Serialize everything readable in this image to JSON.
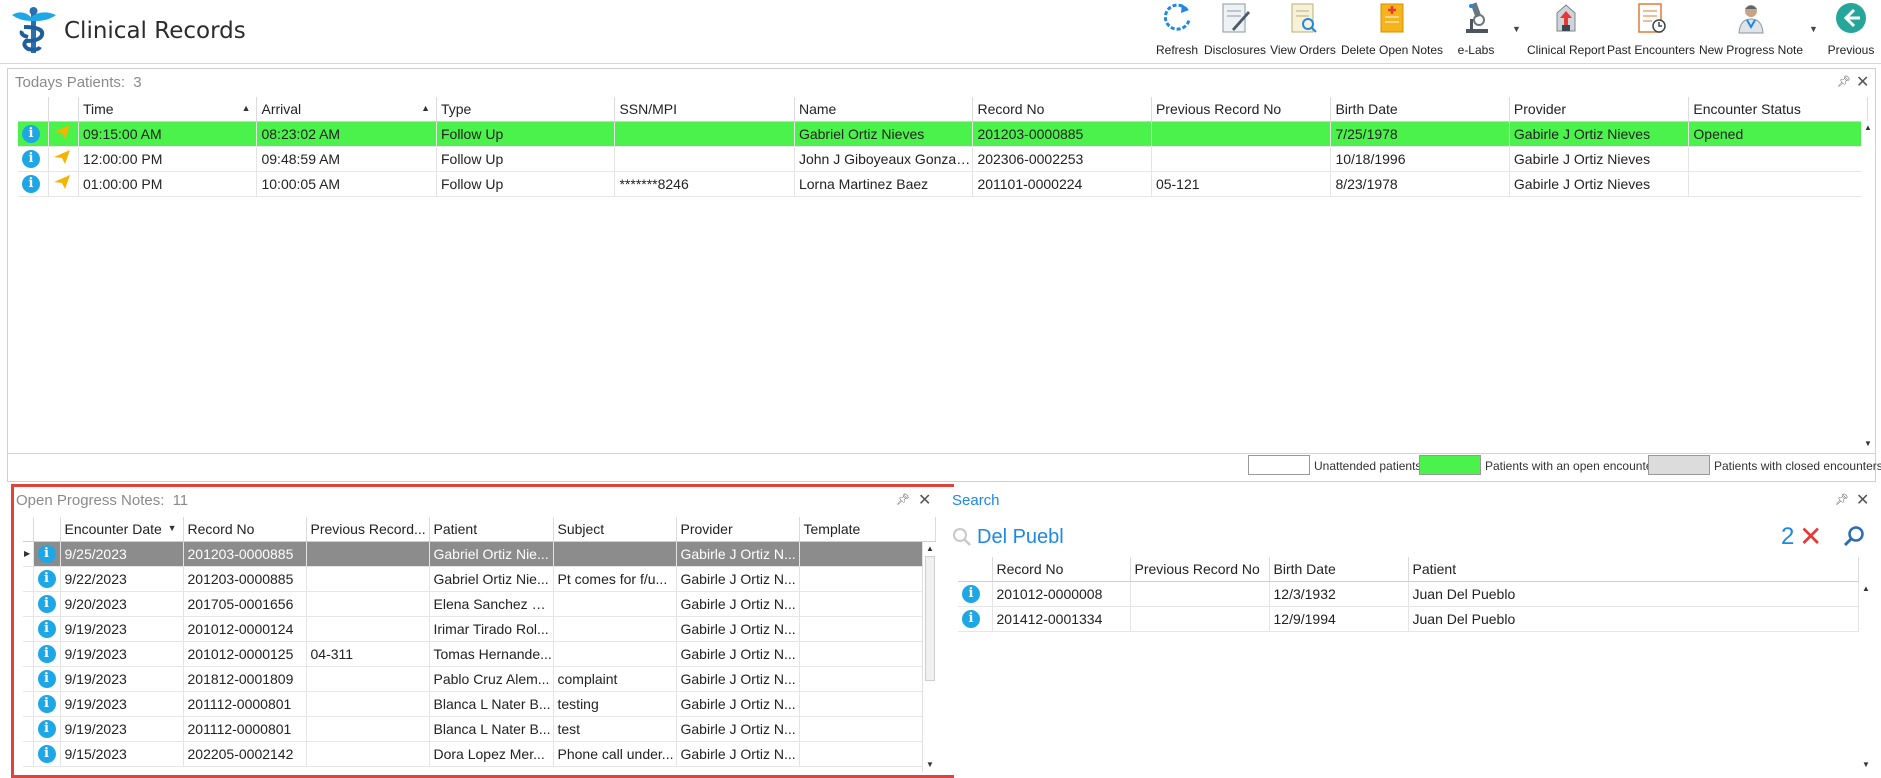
{
  "app": {
    "title": "Clinical Records"
  },
  "toolbar": [
    {
      "label": "Refresh",
      "icon": "refresh-icon"
    },
    {
      "label": "Disclosures",
      "icon": "disclosures-icon"
    },
    {
      "label": "View Orders",
      "icon": "view-orders-icon"
    },
    {
      "label": "Delete Open Notes",
      "icon": "delete-notes-icon"
    },
    {
      "label": "e-Labs",
      "icon": "microscope-icon"
    },
    {
      "label": "Clinical Report",
      "icon": "clinical-report-icon"
    },
    {
      "label": "Past Encounters",
      "icon": "past-encounters-icon"
    },
    {
      "label": "New Progress Note",
      "icon": "doctor-icon"
    },
    {
      "label": "Previous",
      "icon": "back-arrow-icon"
    }
  ],
  "todays": {
    "title": "Todays Patients:",
    "count": "3",
    "columns": [
      "Time",
      "Arrival",
      "Type",
      "SSN/MPI",
      "Name",
      "Record No",
      "Previous Record No",
      "Birth Date",
      "Provider",
      "Encounter Status"
    ],
    "rows": [
      [
        "09:15:00 AM",
        "08:23:02 AM",
        "Follow Up",
        "",
        "Gabriel Ortiz Nieves",
        "201203-0000885",
        "",
        "7/25/1978",
        "Gabirle J Ortiz Nieves",
        "Opened"
      ],
      [
        "12:00:00 PM",
        "09:48:59 AM",
        "Follow Up",
        "",
        "John J Giboyeaux Gonzalez",
        "202306-0002253",
        "",
        "10/18/1996",
        "Gabirle J Ortiz Nieves",
        ""
      ],
      [
        "01:00:00 PM",
        "10:00:05 AM",
        "Follow Up",
        "*******8246",
        "Lorna Martinez Baez",
        "201101-0000224",
        "05-121",
        "8/23/1978",
        "Gabirle J Ortiz Nieves",
        ""
      ]
    ],
    "legend": [
      "Unattended patients",
      "Patients with an open encounter",
      "Patients with closed encounters"
    ]
  },
  "notes": {
    "title": "Open Progress Notes:",
    "count": "11",
    "columns": [
      "Encounter Date",
      "Record No",
      "Previous Record...",
      "Patient",
      "Subject",
      "Provider",
      "Template"
    ],
    "rows": [
      [
        "9/25/2023",
        "201203-0000885",
        "",
        "Gabriel Ortiz Nie...",
        "",
        "Gabirle J Ortiz N...",
        ""
      ],
      [
        "9/22/2023",
        "201203-0000885",
        "",
        "Gabriel Ortiz Nie...",
        "Pt comes for f/u...",
        "Gabirle J Ortiz N...",
        ""
      ],
      [
        "9/20/2023",
        "201705-0001656",
        "",
        "Elena Sanchez Ri...",
        "",
        "Gabirle J Ortiz N...",
        ""
      ],
      [
        "9/19/2023",
        "201012-0000124",
        "",
        "Irimar Tirado Rol...",
        "",
        "Gabirle J Ortiz N...",
        ""
      ],
      [
        "9/19/2023",
        "201012-0000125",
        "04-311",
        "Tomas Hernande...",
        "",
        "Gabirle J Ortiz N...",
        ""
      ],
      [
        "9/19/2023",
        "201812-0001809",
        "",
        "Pablo Cruz Alem...",
        "complaint",
        "Gabirle J Ortiz N...",
        ""
      ],
      [
        "9/19/2023",
        "201112-0000801",
        "",
        "Blanca L Nater B...",
        "testing",
        "Gabirle J Ortiz N...",
        ""
      ],
      [
        "9/19/2023",
        "201112-0000801",
        "",
        "Blanca L Nater B...",
        "test",
        "Gabirle J Ortiz N...",
        ""
      ],
      [
        "9/15/2023",
        "202205-0002142",
        "",
        "Dora Lopez Mer...",
        "Phone call under...",
        "Gabirle J Ortiz N...",
        ""
      ]
    ]
  },
  "search": {
    "title": "Search",
    "query": "Del Puebl",
    "result_count": "2",
    "columns": [
      "Record No",
      "Previous Record No",
      "Birth Date",
      "Patient"
    ],
    "rows": [
      [
        "201012-0000008",
        "",
        "12/3/1932",
        "Juan Del Pueblo"
      ],
      [
        "201412-0001334",
        "",
        "12/9/1994",
        "Juan Del Pueblo"
      ]
    ]
  },
  "colors": {
    "open_encounter": "#4cf24c",
    "selected_row": "#8c8c8c",
    "accent": "#1e88e5",
    "highlight_frame": "#e0433a"
  }
}
